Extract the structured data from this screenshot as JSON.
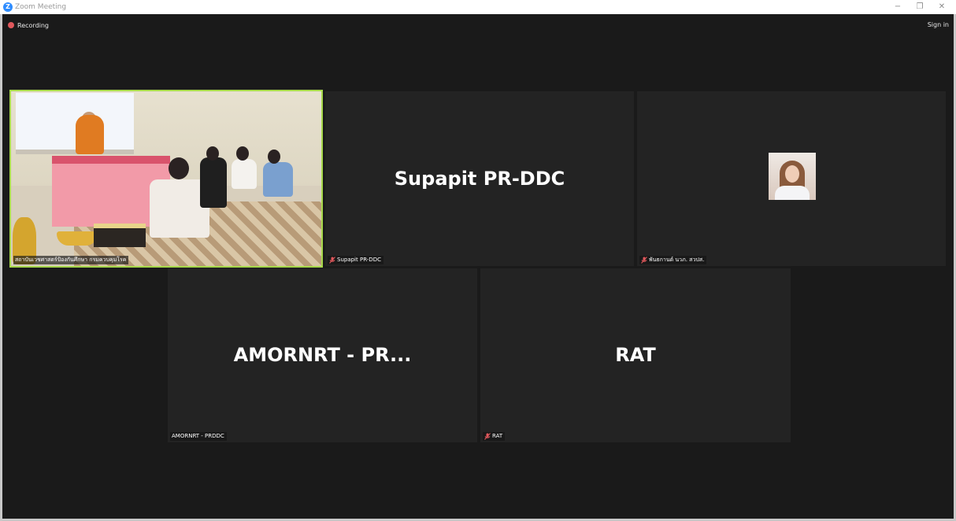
{
  "window": {
    "title": "Zoom Meeting",
    "minimize_glyph": "−",
    "restore_glyph": "❐",
    "close_glyph": "✕"
  },
  "toolbar": {
    "recording_label": "Recording",
    "signin_label": "Sign in"
  },
  "participants": [
    {
      "label": "สถาบันเวชศาสตร์ป้องกันศึกษา กรมควบคุมโรค",
      "muted": false,
      "active": true,
      "video": true
    },
    {
      "name": "Supapit PR-DDC",
      "label": "Supapit PR-DDC",
      "muted": true
    },
    {
      "label": "พันธกานต์ นวภ. สวปส.",
      "muted": true,
      "avatar": true
    },
    {
      "name": "AMORNRT - PR...",
      "label": "AMORNRT - PRDDC",
      "muted": false
    },
    {
      "name": "RAT",
      "label": "RAT",
      "muted": true
    }
  ],
  "colors": {
    "background": "#1a1a1a",
    "tile": "#232323",
    "active_border": "#a7d94b",
    "recording_dot": "#e0585c",
    "muted_mic": "#e0585c",
    "zoom_blue": "#2d8cff"
  },
  "icons": {
    "app": "zoom-logo-icon",
    "recording": "recording-dot-icon",
    "muted": "mic-muted-icon"
  }
}
